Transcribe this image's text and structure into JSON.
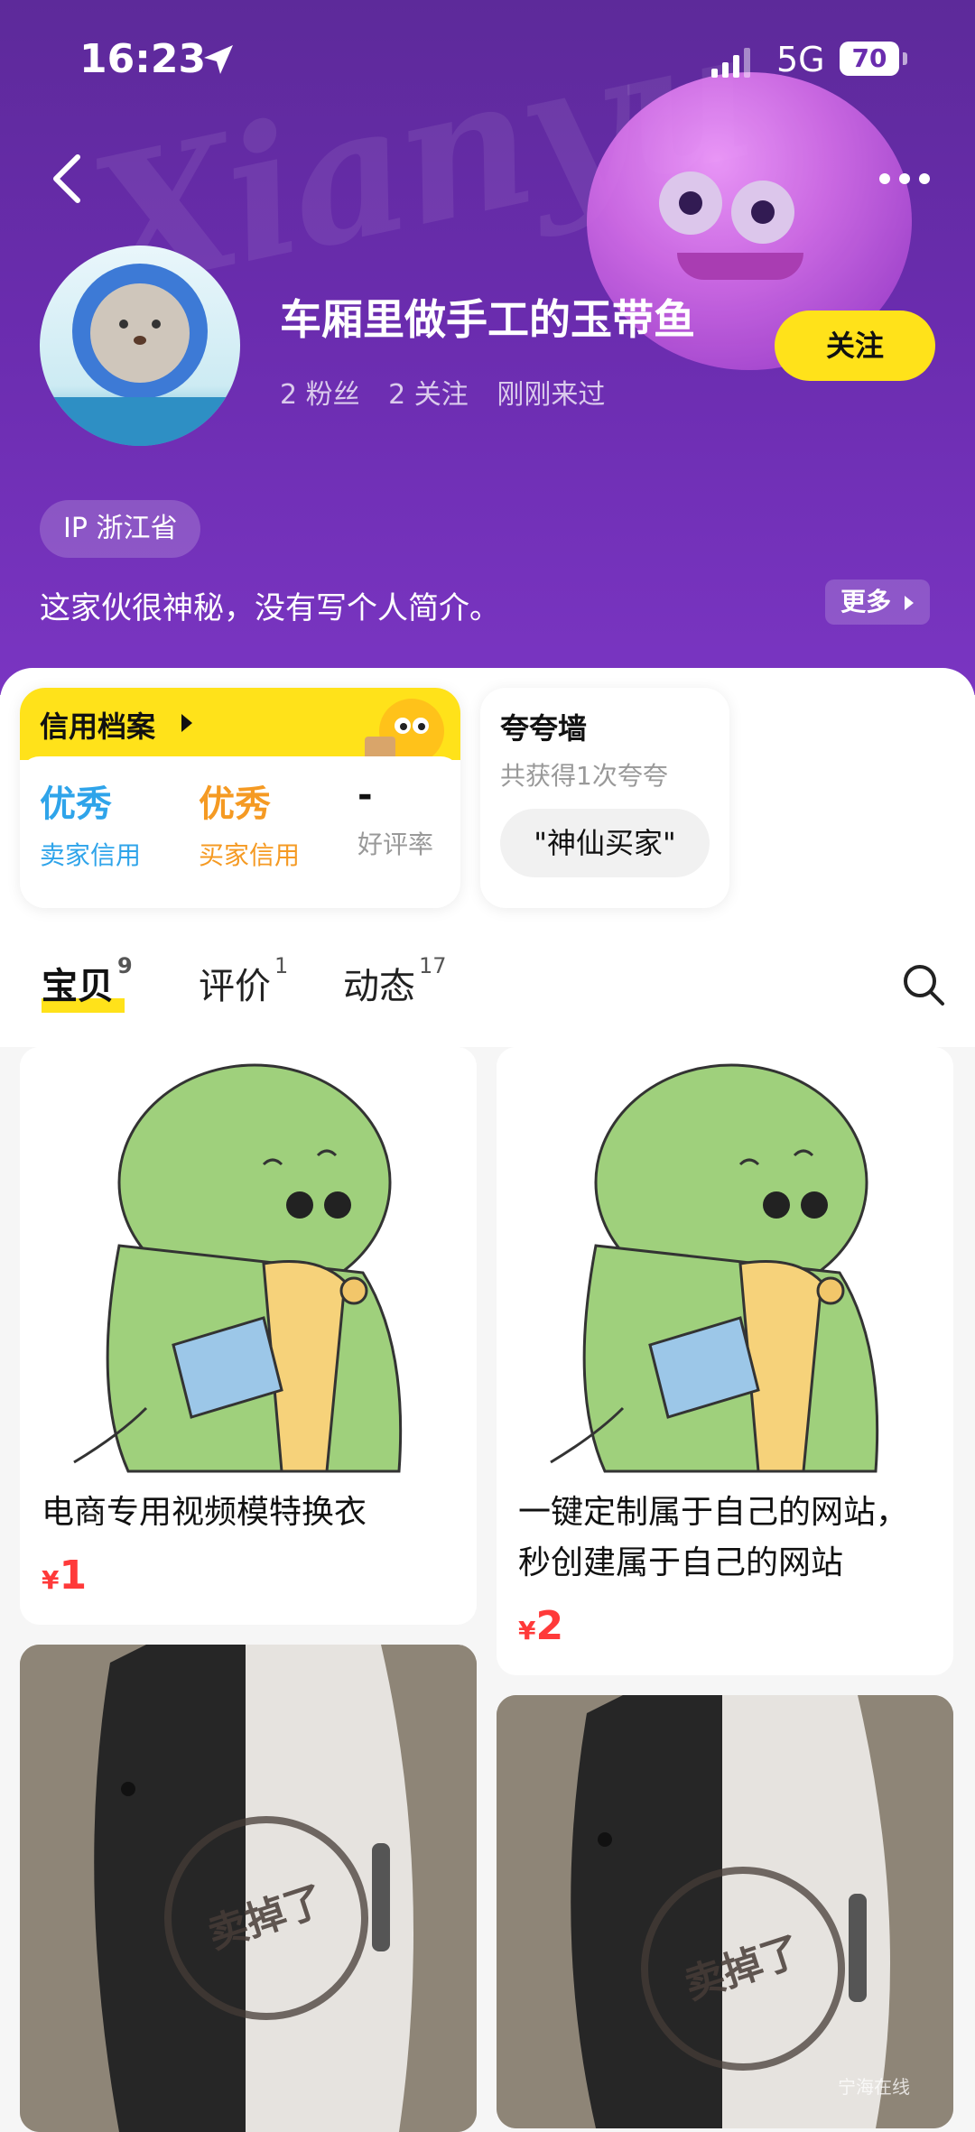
{
  "status": {
    "time": "16:23",
    "network": "5G",
    "battery": "70"
  },
  "header": {
    "nickname": "车厢里做手工的玉带鱼",
    "fans": "2 粉丝",
    "following": "2 关注",
    "last_seen": "刚刚来过",
    "follow_label": "关注",
    "ip": "IP 浙江省",
    "bio": "这家伙很神秘，没有写个人简介。",
    "more_label": "更多",
    "watermark": "Xianyu"
  },
  "credit": {
    "title": "信用档案",
    "stats": [
      {
        "value": "优秀",
        "label": "卖家信用",
        "color": "#2fa4ea"
      },
      {
        "value": "优秀",
        "label": "买家信用",
        "color": "#f59a23"
      },
      {
        "value": "-",
        "label": "好评率",
        "color": "#111111"
      }
    ]
  },
  "praise": {
    "title": "夸夸墙",
    "subtitle": "共获得1次夸夸",
    "badge": "\"神仙买家\""
  },
  "tabs": [
    {
      "label": "宝贝",
      "count": "9"
    },
    {
      "label": "评价",
      "count": "1"
    },
    {
      "label": "动态",
      "count": "17"
    }
  ],
  "products": [
    {
      "title": "电商专用视频模特换衣",
      "price_symbol": "¥",
      "price": "1"
    },
    {
      "title": "一键定制属于自己的网站，秒创建属于自己的网站",
      "price_symbol": "¥",
      "price": "2"
    },
    {
      "stamp": "卖掉了"
    },
    {
      "stamp": "卖掉了"
    }
  ],
  "footer_watermark": "宁海在线"
}
